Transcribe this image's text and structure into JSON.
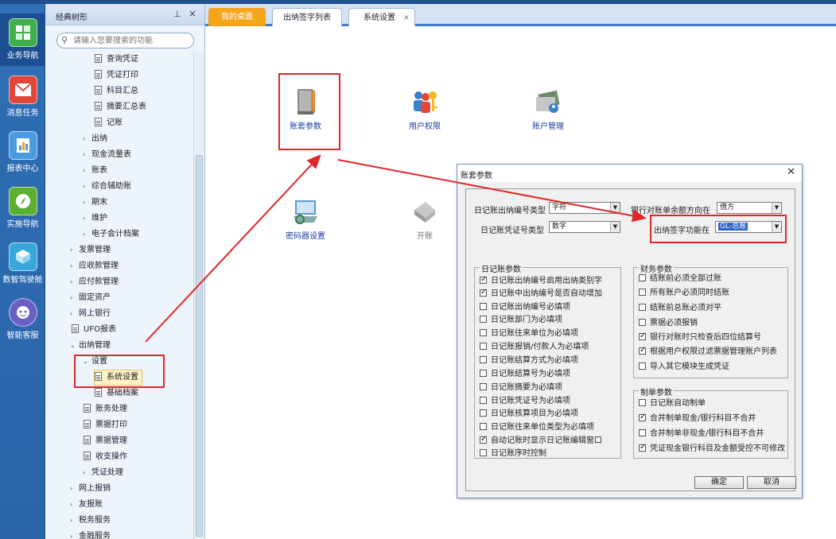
{
  "nav": {
    "items": [
      {
        "label": "业务导航",
        "icon": "business-nav-icon"
      },
      {
        "label": "消息任务",
        "icon": "message-icon"
      },
      {
        "label": "报表中心",
        "icon": "report-icon"
      },
      {
        "label": "实施导航",
        "icon": "compass-icon"
      },
      {
        "label": "数智驾驶舱",
        "icon": "cockpit-icon"
      },
      {
        "label": "智能客服",
        "icon": "service-icon"
      }
    ]
  },
  "tree": {
    "title": "经典树形",
    "search_placeholder": "请输入您要搜索的功能",
    "items": [
      {
        "label": "查询凭证",
        "type": "doc"
      },
      {
        "label": "凭证打印",
        "type": "doc"
      },
      {
        "label": "科目汇总",
        "type": "doc"
      },
      {
        "label": "摘要汇总表",
        "type": "doc"
      },
      {
        "label": "记账",
        "type": "doc"
      },
      {
        "label": "出纳",
        "type": "folder"
      },
      {
        "label": "现金流量表",
        "type": "folder"
      },
      {
        "label": "账表",
        "type": "folder"
      },
      {
        "label": "综合辅助账",
        "type": "folder"
      },
      {
        "label": "期末",
        "type": "folder"
      },
      {
        "label": "维护",
        "type": "folder"
      },
      {
        "label": "电子会计档案",
        "type": "folder"
      },
      {
        "label": "发票管理",
        "type": "folder"
      },
      {
        "label": "应收款管理",
        "type": "folder"
      },
      {
        "label": "应付款管理",
        "type": "folder"
      },
      {
        "label": "固定资产",
        "type": "folder"
      },
      {
        "label": "网上银行",
        "type": "folder"
      },
      {
        "label": "UFO报表",
        "type": "doc"
      },
      {
        "label": "出纳管理",
        "type": "open"
      },
      {
        "label": "设置",
        "type": "open"
      },
      {
        "label": "系统设置",
        "type": "doc"
      },
      {
        "label": "基础档案",
        "type": "doc"
      },
      {
        "label": "账务处理",
        "type": "doc"
      },
      {
        "label": "票据打印",
        "type": "doc"
      },
      {
        "label": "票据管理",
        "type": "doc"
      },
      {
        "label": "收支操作",
        "type": "doc"
      },
      {
        "label": "凭证处理",
        "type": "folder"
      },
      {
        "label": "网上报销",
        "type": "folder"
      },
      {
        "label": "友报账",
        "type": "folder"
      },
      {
        "label": "税务服务",
        "type": "folder"
      },
      {
        "label": "金融服务",
        "type": "folder"
      }
    ]
  },
  "tabs": [
    {
      "label": "我的桌面"
    },
    {
      "label": "出纳签字列表"
    },
    {
      "label": "系统设置",
      "close": "×"
    }
  ],
  "functions": [
    {
      "label": "账套参数",
      "icon": "book-icon"
    },
    {
      "label": "用户权限",
      "icon": "user-key-icon"
    },
    {
      "label": "账户管理",
      "icon": "account-icon"
    },
    {
      "label": "密码器设置",
      "icon": "device-icon"
    },
    {
      "label": "开账",
      "icon": "open-ledger-icon"
    }
  ],
  "dialog": {
    "title": "账套参数",
    "close": "✕",
    "fields": {
      "serial_type_label": "日记账出纳编号类型",
      "serial_type_value": "字符",
      "voucher_type_label": "日记账凭证号类型",
      "voucher_type_value": "数字",
      "balance_dir_label": "银行对账单余额方向在",
      "balance_dir_value": "借方",
      "sign_module_label": "出纳签字功能在",
      "sign_module_value": "GL-总账"
    },
    "journal": {
      "title": "日记账参数",
      "options": [
        {
          "label": "日记账出纳编号启用出纳类别字",
          "checked": true
        },
        {
          "label": "日记账中出纳编号是否自动增加",
          "checked": true
        },
        {
          "label": "日记账出纳编号必填项",
          "checked": false
        },
        {
          "label": "日记账部门为必填项",
          "checked": false
        },
        {
          "label": "日记账往来单位为必填项",
          "checked": false
        },
        {
          "label": "日记账报销/付款人为必填项",
          "checked": false
        },
        {
          "label": "日记账结算方式为必填项",
          "checked": false
        },
        {
          "label": "日记账结算号为必填项",
          "checked": false
        },
        {
          "label": "日记账摘要为必填项",
          "checked": false
        },
        {
          "label": "日记账凭证号为必填项",
          "checked": false
        },
        {
          "label": "日记账核算项目为必填项",
          "checked": false
        },
        {
          "label": "日记账往来单位类型为必填项",
          "checked": false
        },
        {
          "label": "自动记账时显示日记账编辑窗口",
          "checked": true
        },
        {
          "label": "日记账序时控制",
          "checked": false
        }
      ]
    },
    "finance": {
      "title": "财务参数",
      "options": [
        {
          "label": "结账前必须全部过账",
          "checked": false
        },
        {
          "label": "所有账户必须同时结账",
          "checked": false
        },
        {
          "label": "结账前总账必须对平",
          "checked": false
        },
        {
          "label": "票据必须报销",
          "checked": false
        },
        {
          "label": "银行对账时只检查后四位结算号",
          "checked": true
        },
        {
          "label": "根据用户权限过滤票据管理账户列表",
          "checked": true
        },
        {
          "label": "导入其它模块生成凭证",
          "checked": false
        }
      ]
    },
    "voucher": {
      "title": "制单参数",
      "options": [
        {
          "label": "日记账自动制单",
          "checked": false
        },
        {
          "label": "合并制单现金/银行科目不合并",
          "checked": true
        },
        {
          "label": "合并制单非现金/银行科目不合并",
          "checked": false
        },
        {
          "label": "凭证现金银行科目及金额受控不可修改",
          "checked": true
        }
      ]
    },
    "ok": "确定",
    "cancel": "取消"
  },
  "colors": {
    "nav_bg": "#2f6fb6",
    "accent_tab": "#f5a51c",
    "highlight": "#e0262a"
  }
}
